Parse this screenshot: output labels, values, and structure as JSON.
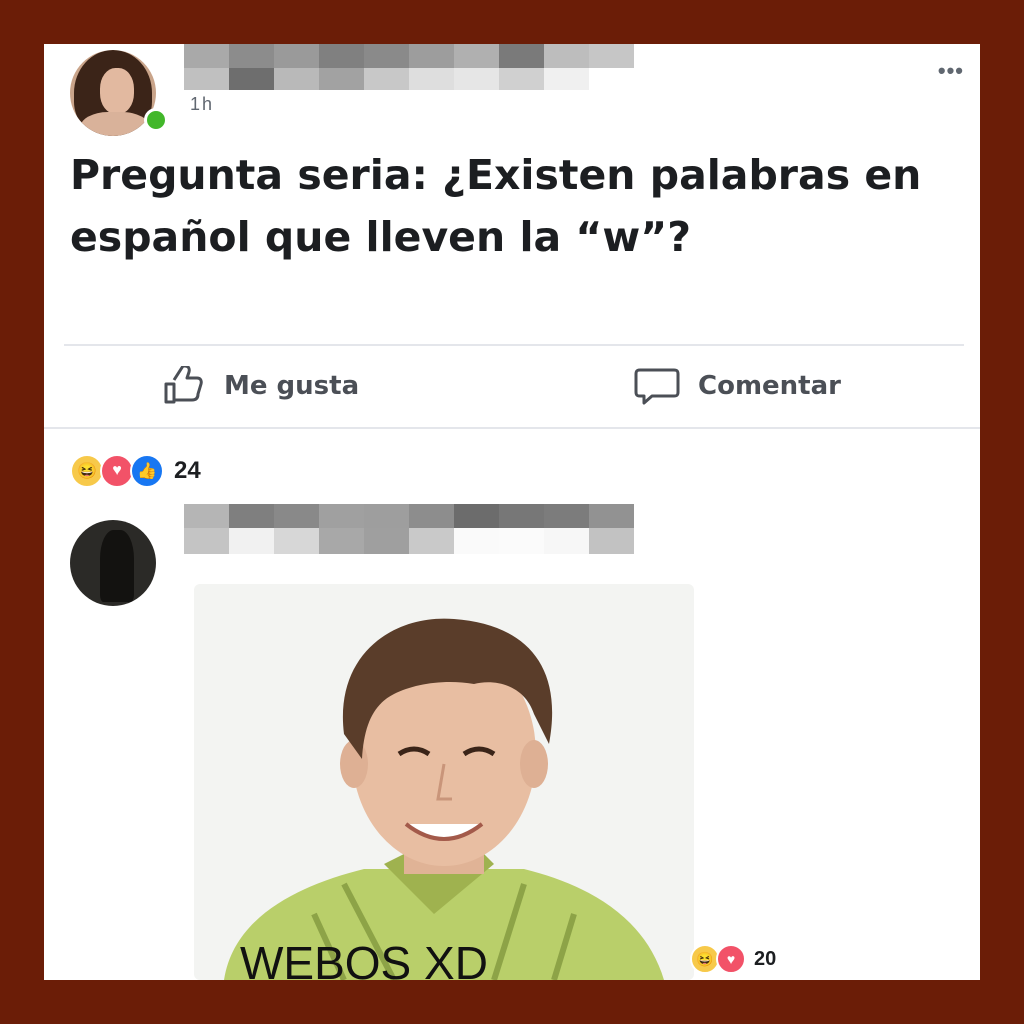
{
  "post": {
    "timestamp": "1h",
    "text": "Pregunta seria: ¿Existen palabras en español que lleven la “w”?",
    "more_icon": "more-options-icon"
  },
  "actions": {
    "like_label": "Me gusta",
    "comment_label": "Comentar"
  },
  "reactions": {
    "icons": [
      "haha-icon",
      "love-icon",
      "like-icon"
    ],
    "count": "24"
  },
  "comment": {
    "meme_caption": "WEBOS XD",
    "reactions": {
      "icons": [
        "haha-icon",
        "love-icon"
      ],
      "count": "20"
    }
  },
  "colors": {
    "frame": "#6b1d07",
    "card": "#ffffff",
    "text": "#1c1e21",
    "secondary_text": "#4b4f56",
    "online": "#42b72a"
  }
}
